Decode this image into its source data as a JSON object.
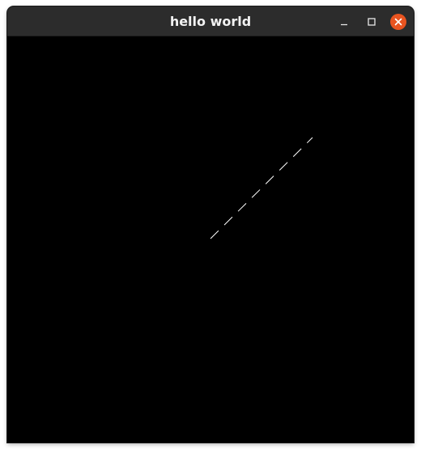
{
  "window": {
    "title": "hello world"
  },
  "controls": {
    "minimize_icon": "minimize-icon",
    "maximize_icon": "maximize-icon",
    "close_icon": "close-icon"
  },
  "canvas": {
    "background": "#000000",
    "line_color": "#ffffff",
    "close_button_color": "#e95420"
  }
}
